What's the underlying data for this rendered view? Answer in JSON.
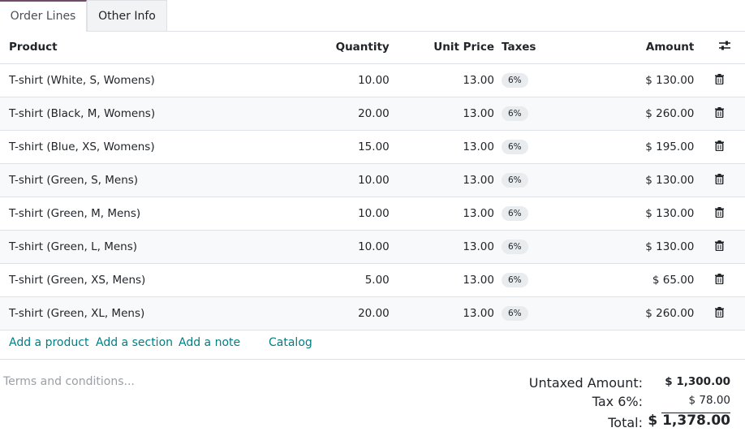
{
  "tabs": [
    "Order Lines",
    "Other Info"
  ],
  "columns": {
    "product": "Product",
    "quantity": "Quantity",
    "unit_price": "Unit Price",
    "taxes": "Taxes",
    "amount": "Amount"
  },
  "icons": {
    "column_settings": "sliders-icon",
    "delete": "trash-icon"
  },
  "lines": [
    {
      "product": "T-shirt (White, S, Womens)",
      "quantity": "10.00",
      "unit_price": "13.00",
      "tax": "6%",
      "amount": "$ 130.00"
    },
    {
      "product": "T-shirt (Black, M, Womens)",
      "quantity": "20.00",
      "unit_price": "13.00",
      "tax": "6%",
      "amount": "$ 260.00"
    },
    {
      "product": "T-shirt (Blue, XS, Womens)",
      "quantity": "15.00",
      "unit_price": "13.00",
      "tax": "6%",
      "amount": "$ 195.00"
    },
    {
      "product": "T-shirt (Green, S, Mens)",
      "quantity": "10.00",
      "unit_price": "13.00",
      "tax": "6%",
      "amount": "$ 130.00"
    },
    {
      "product": "T-shirt (Green, M, Mens)",
      "quantity": "10.00",
      "unit_price": "13.00",
      "tax": "6%",
      "amount": "$ 130.00"
    },
    {
      "product": "T-shirt (Green, L, Mens)",
      "quantity": "10.00",
      "unit_price": "13.00",
      "tax": "6%",
      "amount": "$ 130.00"
    },
    {
      "product": "T-shirt (Green, XS, Mens)",
      "quantity": "5.00",
      "unit_price": "13.00",
      "tax": "6%",
      "amount": "$ 65.00"
    },
    {
      "product": "T-shirt (Green, XL, Mens)",
      "quantity": "20.00",
      "unit_price": "13.00",
      "tax": "6%",
      "amount": "$ 260.00"
    }
  ],
  "actions": {
    "add_product": "Add a product",
    "add_section": "Add a section",
    "add_note": "Add a note",
    "catalog": "Catalog"
  },
  "terms_placeholder": "Terms and conditions...",
  "totals": {
    "untaxed_label": "Untaxed Amount:",
    "untaxed_value": "$ 1,300.00",
    "tax_label": "Tax 6%:",
    "tax_value": "$ 78.00",
    "total_label": "Total:",
    "total_value": "$ 1,378.00"
  },
  "colors": {
    "accent": "#714b67",
    "link": "#017e84",
    "border": "#dee2e6",
    "stripe": "#f8f9fa"
  }
}
